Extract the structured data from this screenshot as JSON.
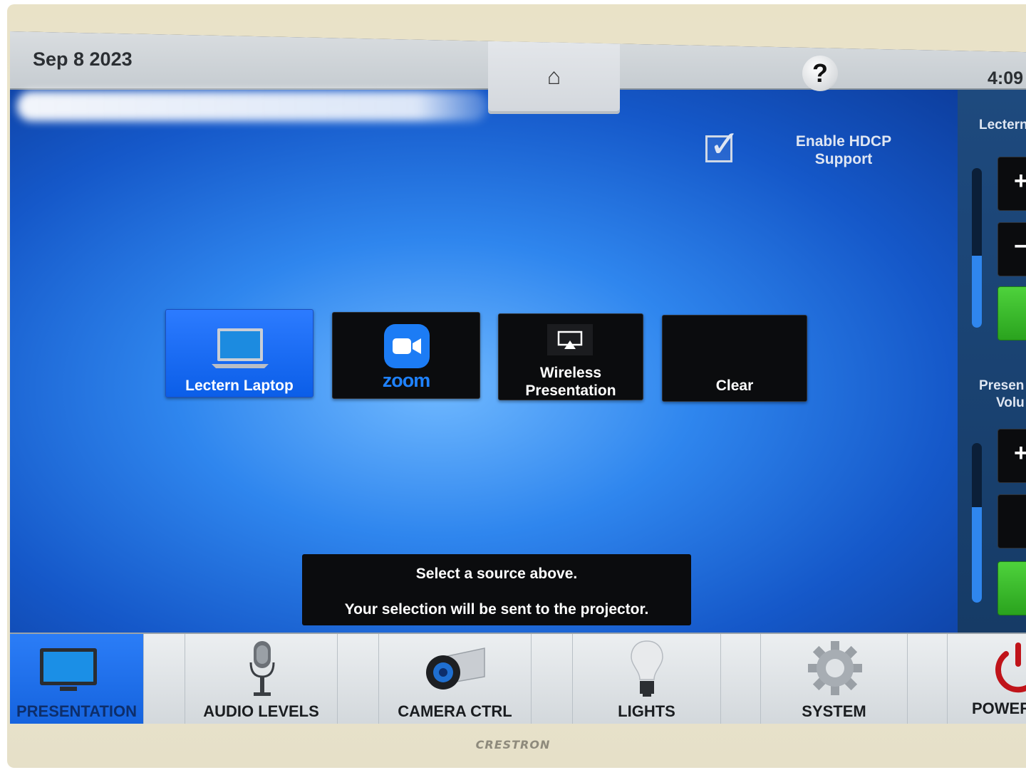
{
  "header": {
    "date": "Sep 8 2023",
    "home_icon": "home-icon",
    "help_label": "?",
    "time": "4:09"
  },
  "hdcp": {
    "checked": true,
    "label_line1": "Enable HDCP",
    "label_line2": "Support"
  },
  "sources": [
    {
      "label": "Lectern Laptop",
      "icon": "laptop-icon",
      "selected": true
    },
    {
      "label": "zoom",
      "icon": "zoom-icon",
      "selected": false
    },
    {
      "label_line1": "Wireless",
      "label_line2": "Presentation",
      "icon": "airplay-icon",
      "selected": false
    },
    {
      "label": "Clear",
      "selected": false
    }
  ],
  "message": {
    "line1": "Select a source above.",
    "line2": "Your selection will be sent to the projector."
  },
  "right_panel": {
    "lectern_label": "Lectern",
    "lectern_level": 0.45,
    "presentation_label_line1": "Presen",
    "presentation_label_line2": "Volu",
    "presentation_level": 0.6
  },
  "nav": [
    {
      "label": "PRESENTATION",
      "icon": "monitor-icon",
      "active": true
    },
    {
      "label": "AUDIO LEVELS",
      "icon": "microphone-icon",
      "active": false
    },
    {
      "label": "CAMERA CTRL",
      "icon": "camera-icon",
      "active": false
    },
    {
      "label": "LIGHTS",
      "icon": "lightbulb-icon",
      "active": false
    },
    {
      "label": "SYSTEM",
      "icon": "gear-icon",
      "active": false
    },
    {
      "label": "POWER",
      "icon": "power-icon",
      "active": false
    }
  ],
  "brand": "CRESTRON",
  "colors": {
    "accent_blue": "#1563de",
    "button_dark": "#0b0c0e",
    "volume_green": "#2aa31e",
    "background_blue": "#2f86ee"
  }
}
